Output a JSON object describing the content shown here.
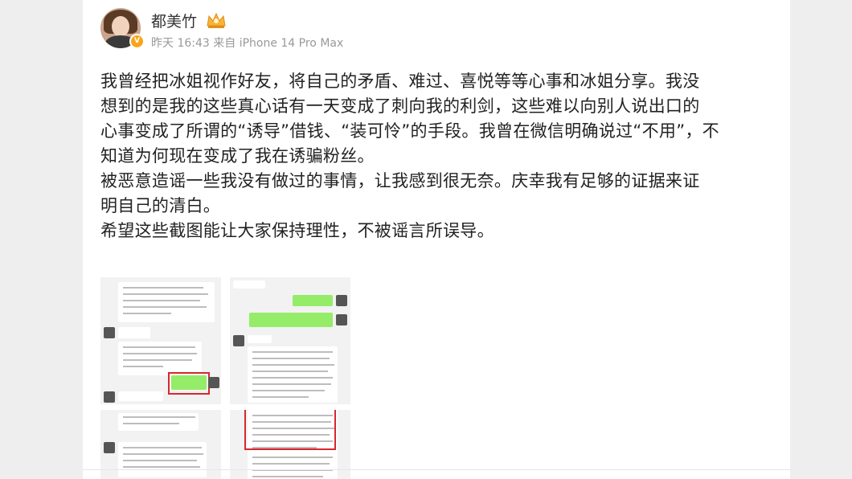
{
  "post": {
    "username": "都美竹",
    "meta": "昨天 16:43 来自 iPhone 14 Pro Max",
    "text": "我曾经把冰姐视作好友，将自己的矛盾、难过、喜悦等等心事和冰姐分享。我没\n想到的是我的这些真心话有一天变成了刺向我的利剑，这些难以向别人说出口的\n心事变成了所谓的“诱导”借钱、“装可怜”的手段。我曾在微信明确说过“不用”，不\n知道为何现在变成了我在诱骗粉丝。\n被恶意造谣一些我没有做过的事情，让我感到很无奈。庆幸我有足够的证据来证\n明自己的清白。\n希望这些截图能让大家保持理性，不被谣言所误导。"
  },
  "colors": {
    "verified_badge": "#f7a61b",
    "highlight_box": "#d8272f",
    "chat_green": "#95ec69"
  },
  "icons": [
    "verified-badge-icon",
    "crown-vip-icon"
  ]
}
